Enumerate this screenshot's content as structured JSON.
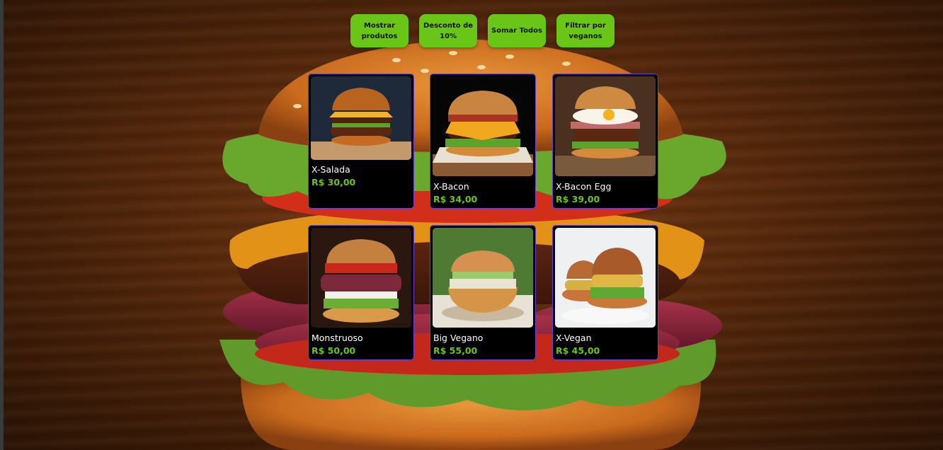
{
  "toolbar": {
    "buttons": [
      {
        "label": "Mostrar produtos"
      },
      {
        "label": "Desconto de 10%"
      },
      {
        "label": "Somar Todos"
      },
      {
        "label": "Filtrar por veganos"
      }
    ]
  },
  "products": [
    {
      "name": "X-Salada",
      "price": "R$ 30,00",
      "image": "burger-photo-x-salada"
    },
    {
      "name": "X-Bacon",
      "price": "R$ 34,00",
      "image": "burger-photo-x-bacon"
    },
    {
      "name": "X-Bacon Egg",
      "price": "R$ 39,00",
      "image": "burger-photo-x-bacon-egg"
    },
    {
      "name": "Monstruoso",
      "price": "R$ 50,00",
      "image": "burger-photo-monstruoso"
    },
    {
      "name": "Big Vegano",
      "price": "R$ 55,00",
      "image": "burger-photo-big-vegano"
    },
    {
      "name": "X-Vegan",
      "price": "R$ 45,00",
      "image": "burger-photo-x-vegan"
    }
  ],
  "colors": {
    "accent": "#6ac616",
    "card_border": "#6b3fd6",
    "card_background": "#000000",
    "background": "#5a2a0c"
  }
}
